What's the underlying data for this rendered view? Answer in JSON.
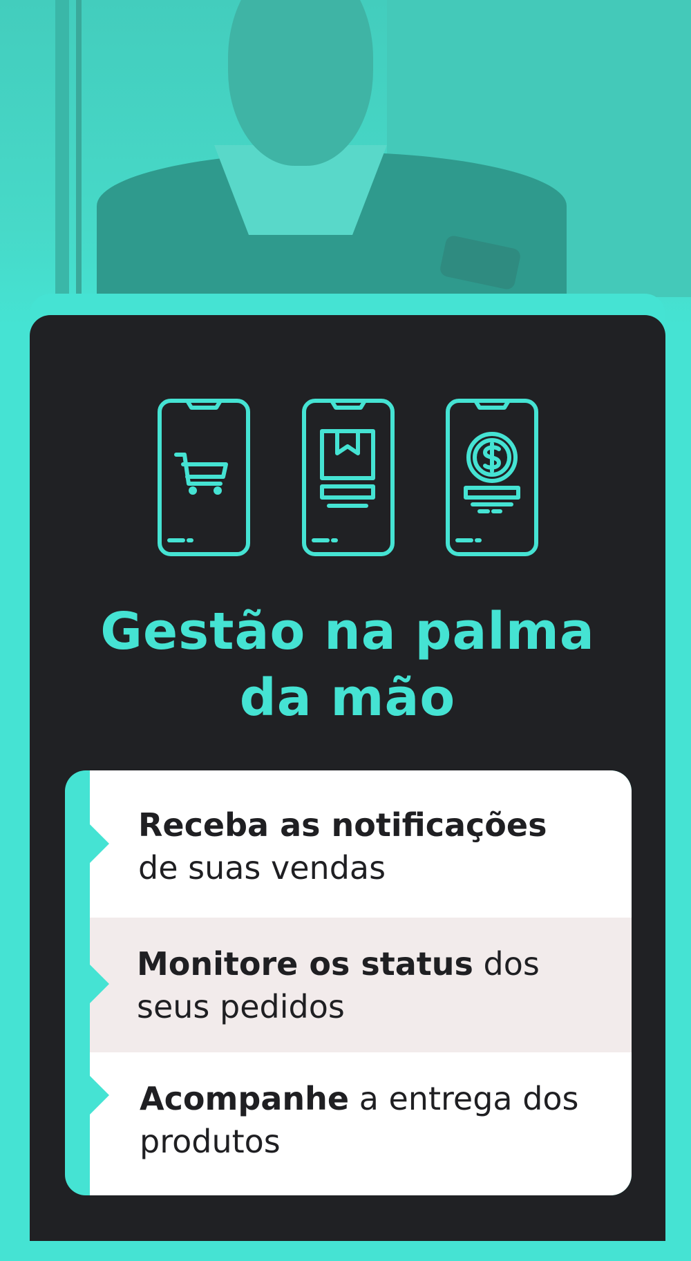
{
  "colors": {
    "accent": "#45e3d3",
    "card_background": "#202124",
    "highlight_row": "#f2ebeb",
    "text_dark": "#1f1f22"
  },
  "hero": {
    "image": "man-smiling-holding-phone-photo"
  },
  "icons": [
    {
      "name": "phone-cart-icon"
    },
    {
      "name": "phone-package-icon"
    },
    {
      "name": "phone-dollar-icon"
    }
  ],
  "headline": {
    "line1": "Gestão na palma",
    "line2": "da mão"
  },
  "features": [
    {
      "bold": "Receba as notificações",
      "text": "de suas vendas"
    },
    {
      "bold": "Monitore os status",
      "text": " dos seus pedidos"
    },
    {
      "bold": "Acompanhe",
      "text": " a entrega dos produtos"
    }
  ]
}
